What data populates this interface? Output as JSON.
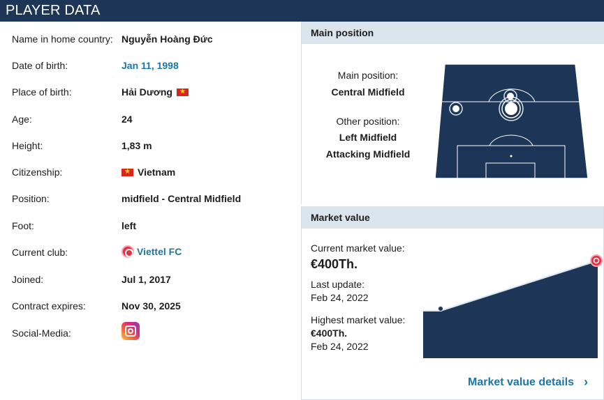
{
  "header": {
    "title": "PLAYER DATA"
  },
  "info_rows": [
    {
      "label": "Name in home country:",
      "value": "Nguyễn Hoàng Đức"
    },
    {
      "label": "Date of birth:",
      "value": "Jan 11, 1998"
    },
    {
      "label": "Place of birth:",
      "value": "Hải Dương"
    },
    {
      "label": "Age:",
      "value": "24"
    },
    {
      "label": "Height:",
      "value": "1,83 m"
    },
    {
      "label": "Citizenship:",
      "value": "Vietnam"
    },
    {
      "label": "Position:",
      "value": "midfield - Central Midfield"
    },
    {
      "label": "Foot:",
      "value": "left"
    },
    {
      "label": "Current club:",
      "value": "Viettel FC"
    },
    {
      "label": "Joined:",
      "value": "Jul 1, 2017"
    },
    {
      "label": "Contract expires:",
      "value": "Nov 30, 2025"
    },
    {
      "label": "Social-Media:",
      "value": ""
    }
  ],
  "icons": {
    "flag": "vietnam-flag-icon",
    "club": "viettel-fc-logo",
    "social": "instagram-icon"
  },
  "colors": {
    "header_bg": "#1d3557",
    "link": "#1d75a3",
    "panel_head_bg": "#dbe5ee",
    "pitch": "#1d3557",
    "accent": "#e03146"
  },
  "position_panel": {
    "title": "Main position",
    "main_label": "Main position:",
    "main_value": "Central Midfield",
    "other_label": "Other position:",
    "other_values": [
      "Left Midfield",
      "Attacking Midfield"
    ]
  },
  "market_panel": {
    "title": "Market value",
    "current_label": "Current market value:",
    "current_value": "€400Th.",
    "update_label": "Last update:",
    "update_value": "Feb 24, 2022",
    "highest_label": "Highest market value:",
    "highest_value": "€400Th.",
    "highest_date": "Feb 24, 2022",
    "details_link": "Market value details"
  }
}
